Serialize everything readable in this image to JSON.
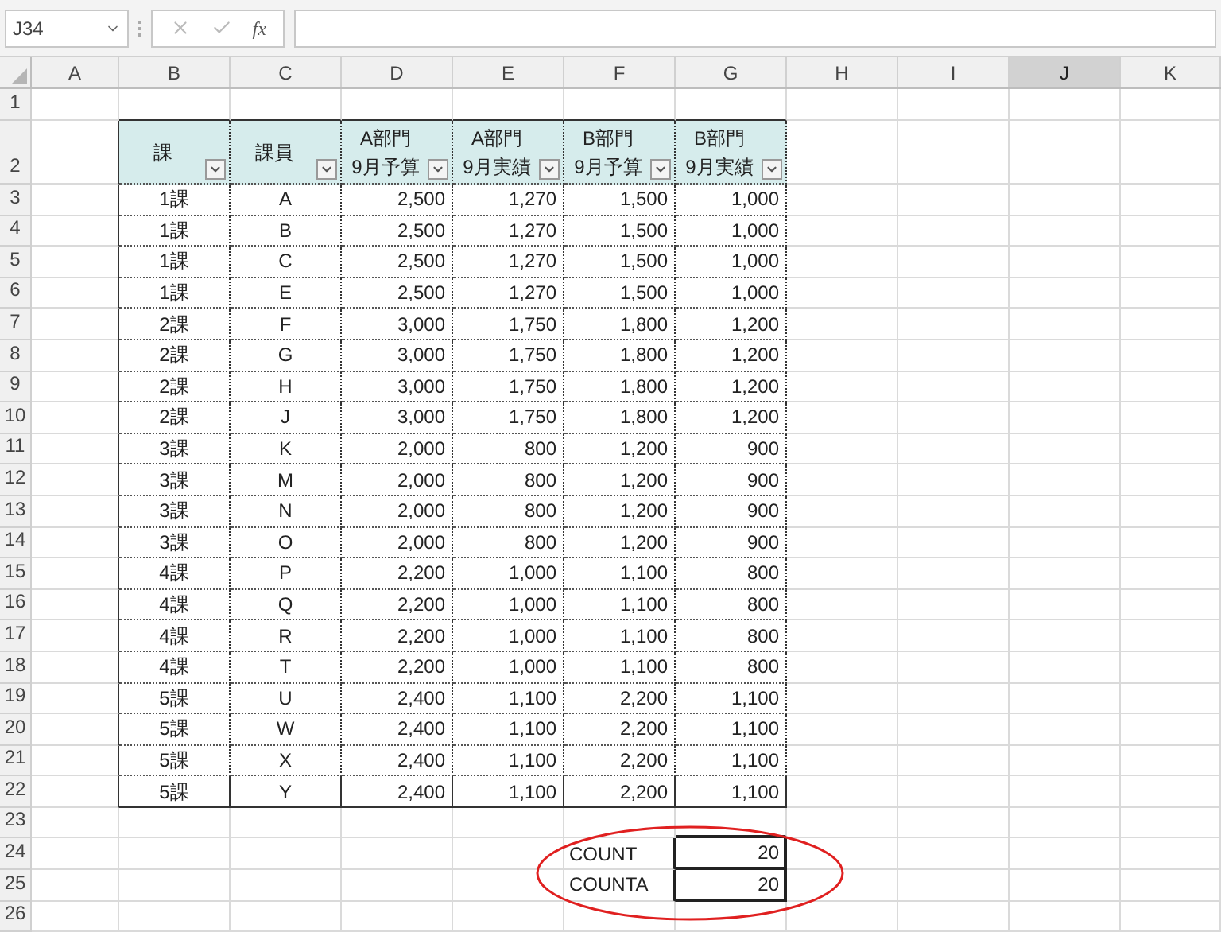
{
  "name_box": "J34",
  "formula_bar": {
    "function_label": "fx"
  },
  "columns": [
    {
      "label": "A",
      "selected": false
    },
    {
      "label": "B",
      "selected": false
    },
    {
      "label": "C",
      "selected": false
    },
    {
      "label": "D",
      "selected": false
    },
    {
      "label": "E",
      "selected": false
    },
    {
      "label": "F",
      "selected": false
    },
    {
      "label": "G",
      "selected": false
    },
    {
      "label": "H",
      "selected": false
    },
    {
      "label": "I",
      "selected": false
    },
    {
      "label": "J",
      "selected": true
    },
    {
      "label": "K",
      "selected": false
    }
  ],
  "row_numbers": [
    "1",
    "2",
    "3",
    "4",
    "5",
    "6",
    "7",
    "8",
    "9",
    "10",
    "11",
    "12",
    "13",
    "14",
    "15",
    "16",
    "17",
    "18",
    "19",
    "20",
    "21",
    "22",
    "23",
    "24",
    "25",
    "26"
  ],
  "table": {
    "headers": [
      {
        "lines": [
          "課"
        ]
      },
      {
        "lines": [
          "課員"
        ]
      },
      {
        "lines": [
          "A部門",
          "9月予算"
        ]
      },
      {
        "lines": [
          "A部門",
          "9月実績"
        ]
      },
      {
        "lines": [
          "B部門",
          "9月予算"
        ]
      },
      {
        "lines": [
          "B部門",
          "9月実績"
        ]
      }
    ],
    "rows": [
      [
        "1課",
        "A",
        "2,500",
        "1,270",
        "1,500",
        "1,000"
      ],
      [
        "1課",
        "B",
        "2,500",
        "1,270",
        "1,500",
        "1,000"
      ],
      [
        "1課",
        "C",
        "2,500",
        "1,270",
        "1,500",
        "1,000"
      ],
      [
        "1課",
        "E",
        "2,500",
        "1,270",
        "1,500",
        "1,000"
      ],
      [
        "2課",
        "F",
        "3,000",
        "1,750",
        "1,800",
        "1,200"
      ],
      [
        "2課",
        "G",
        "3,000",
        "1,750",
        "1,800",
        "1,200"
      ],
      [
        "2課",
        "H",
        "3,000",
        "1,750",
        "1,800",
        "1,200"
      ],
      [
        "2課",
        "J",
        "3,000",
        "1,750",
        "1,800",
        "1,200"
      ],
      [
        "3課",
        "K",
        "2,000",
        "800",
        "1,200",
        "900"
      ],
      [
        "3課",
        "M",
        "2,000",
        "800",
        "1,200",
        "900"
      ],
      [
        "3課",
        "N",
        "2,000",
        "800",
        "1,200",
        "900"
      ],
      [
        "3課",
        "O",
        "2,000",
        "800",
        "1,200",
        "900"
      ],
      [
        "4課",
        "P",
        "2,200",
        "1,000",
        "1,100",
        "800"
      ],
      [
        "4課",
        "Q",
        "2,200",
        "1,000",
        "1,100",
        "800"
      ],
      [
        "4課",
        "R",
        "2,200",
        "1,000",
        "1,100",
        "800"
      ],
      [
        "4課",
        "T",
        "2,200",
        "1,000",
        "1,100",
        "800"
      ],
      [
        "5課",
        "U",
        "2,400",
        "1,100",
        "2,200",
        "1,100"
      ],
      [
        "5課",
        "W",
        "2,400",
        "1,100",
        "2,200",
        "1,100"
      ],
      [
        "5課",
        "X",
        "2,400",
        "1,100",
        "2,200",
        "1,100"
      ],
      [
        "5課",
        "Y",
        "2,400",
        "1,100",
        "2,200",
        "1,100"
      ]
    ]
  },
  "summary": [
    {
      "label": "COUNT",
      "value": "20"
    },
    {
      "label": "COUNTA",
      "value": "20"
    }
  ]
}
